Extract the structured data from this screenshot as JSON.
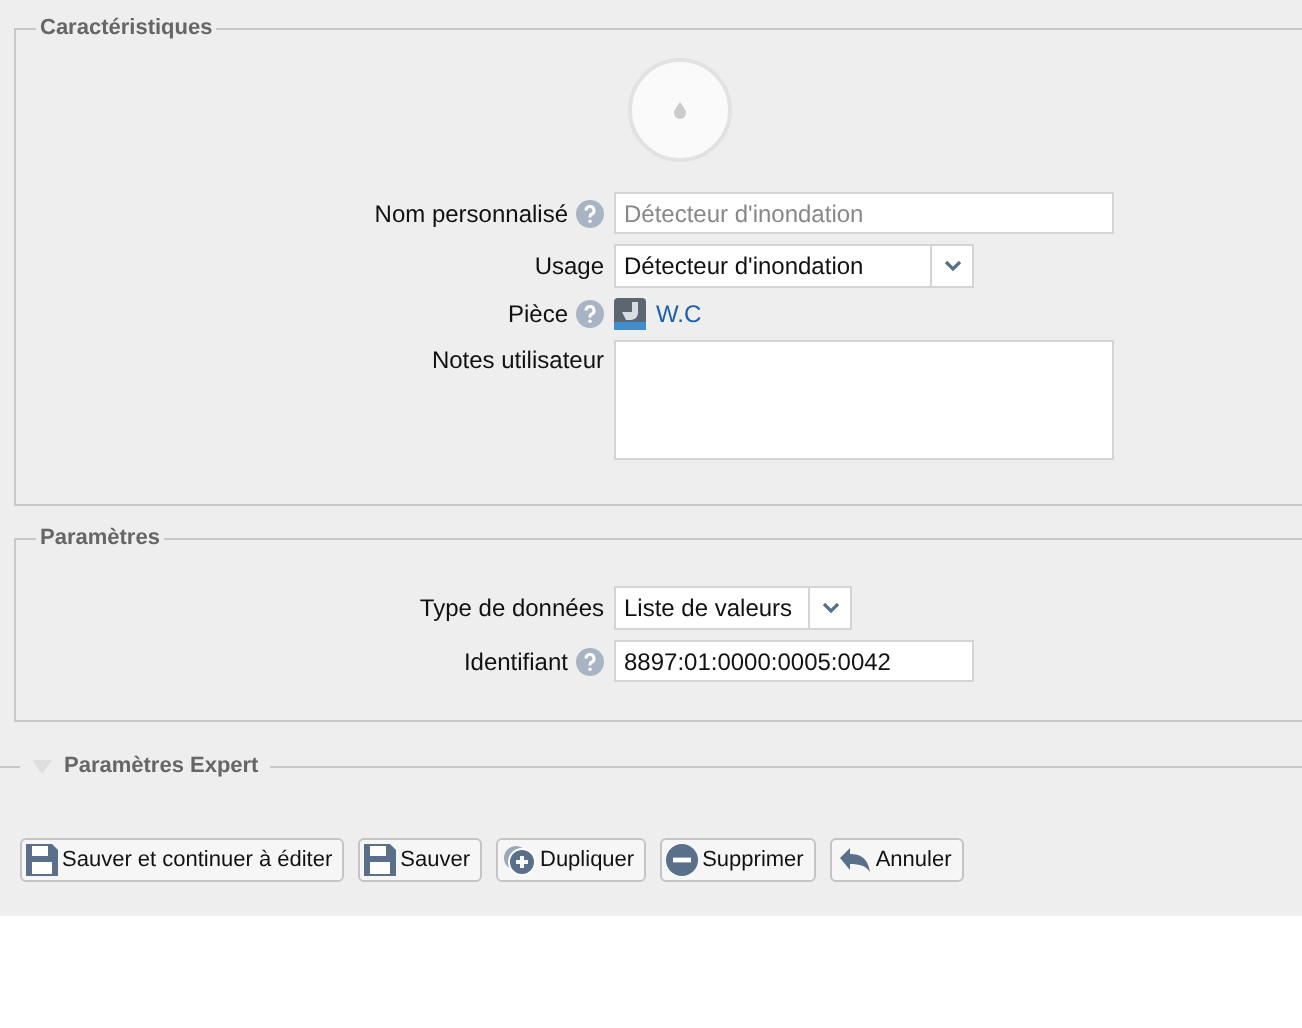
{
  "sections": [
    {
      "legend": "Caractéristiques",
      "kind": "device",
      "fields": [
        {
          "kind": "input",
          "label": "Nom personnalisé",
          "help": true,
          "placeholder": "Détecteur d'inondation"
        },
        {
          "kind": "select",
          "label": "Usage",
          "help": false,
          "value": "Détecteur d'inondation"
        },
        {
          "kind": "link",
          "label": "Pièce",
          "help": true,
          "value": "W.C"
        },
        {
          "kind": "textarea",
          "label": "Notes utilisateur",
          "help": false
        }
      ]
    },
    {
      "legend": "Paramètres",
      "kind": "plain",
      "fields": [
        {
          "kind": "select",
          "label": "Type de données",
          "help": false,
          "value": "Liste de valeurs"
        },
        {
          "kind": "input",
          "label": "Identifiant",
          "help": true,
          "value": "8897:01:0000:0005:0042"
        }
      ]
    }
  ],
  "expert": {
    "label": "Paramètres Expert",
    "expanded": false
  },
  "buttons": [
    {
      "label": "Sauver et continuer à éditer",
      "kind": "save"
    },
    {
      "label": "Sauver",
      "kind": "save"
    },
    {
      "label": "Dupliquer",
      "kind": "duplicate"
    },
    {
      "label": "Supprimer",
      "kind": "delete"
    },
    {
      "label": "Annuler",
      "kind": "undo"
    }
  ]
}
